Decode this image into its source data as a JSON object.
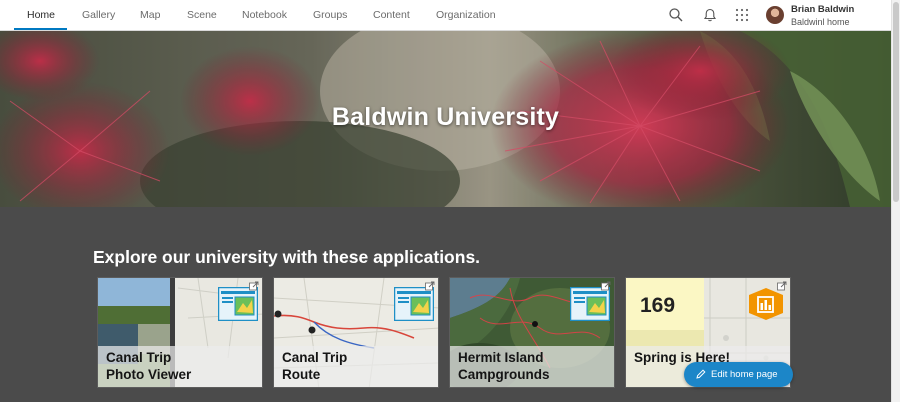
{
  "nav": {
    "items": [
      {
        "label": "Home",
        "active": true
      },
      {
        "label": "Gallery"
      },
      {
        "label": "Map"
      },
      {
        "label": "Scene"
      },
      {
        "label": "Notebook"
      },
      {
        "label": "Groups"
      },
      {
        "label": "Content"
      },
      {
        "label": "Organization"
      }
    ],
    "icons": [
      "search-icon",
      "notification-bell-icon",
      "app-launcher-icon"
    ],
    "user": {
      "name": "Brian Baldwin",
      "org": "Baldwinl home"
    }
  },
  "hero": {
    "title": "Baldwin University"
  },
  "section": {
    "title": "Explore our university with these applications."
  },
  "cards": [
    {
      "line1": "Canal Trip",
      "line2": "Photo Viewer",
      "icon": "web-app-icon"
    },
    {
      "line1": "Canal Trip",
      "line2": "Route",
      "icon": "web-app-icon"
    },
    {
      "line1": "Hermit Island",
      "line2": "Campgrounds",
      "icon": "web-app-icon"
    },
    {
      "line1": "Spring is Here!",
      "line2": "",
      "icon": "dashboard-icon",
      "stat": "169"
    }
  ],
  "edit_button": {
    "label": "Edit home page"
  },
  "colors": {
    "accent": "#0079c1",
    "section_bg": "#4b4b4b",
    "button_bg": "#1c86c8",
    "dashboard_orange": "#f29400"
  }
}
